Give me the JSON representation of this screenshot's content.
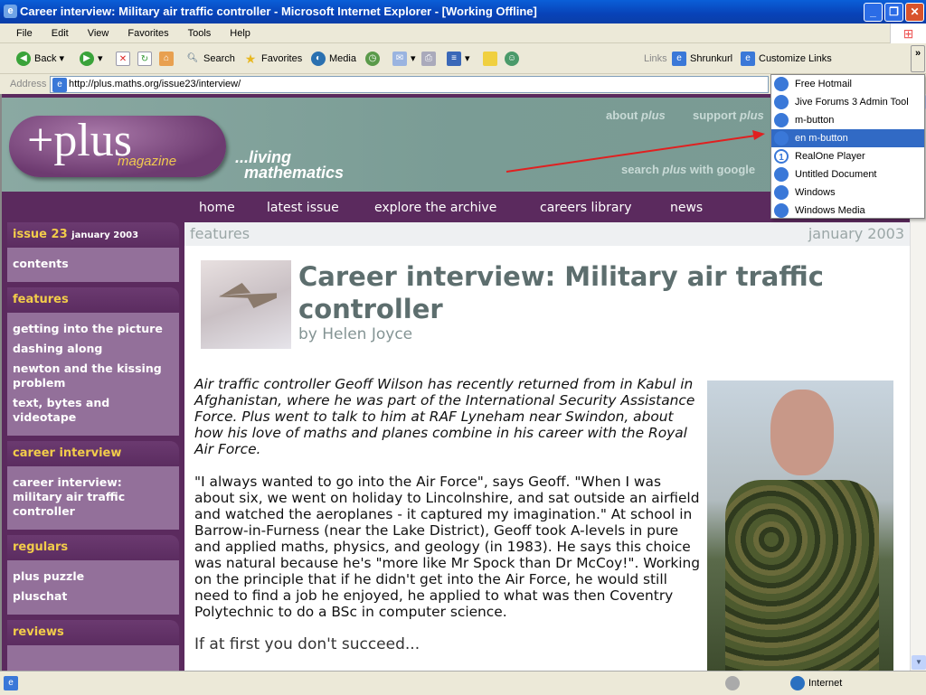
{
  "window": {
    "title": "Career interview: Military air traffic controller - Microsoft Internet Explorer - [Working Offline]"
  },
  "menu": [
    "File",
    "Edit",
    "View",
    "Favorites",
    "Tools",
    "Help"
  ],
  "toolbar": {
    "back": "Back",
    "search": "Search",
    "favorites": "Favorites",
    "media": "Media",
    "links": "Links",
    "link1": "Shrunkurl",
    "link2": "Customize Links",
    "chevron": "»"
  },
  "address": {
    "label": "Address",
    "url": "http://plus.maths.org/issue23/interview/"
  },
  "links_menu": {
    "items": [
      "Free Hotmail",
      "Jive Forums 3 Admin Tool",
      "m-button",
      "en m-button",
      "RealOne Player",
      "Untitled Document",
      "Windows",
      "Windows Media"
    ],
    "selected": 3
  },
  "banner": {
    "logo": "+plus",
    "logo_sub": "magazine",
    "tagline1": "...living",
    "tagline2": "mathematics",
    "about": "about",
    "support": "support",
    "plus": "plus",
    "search_pre": "search",
    "search_post": "with google"
  },
  "nav": [
    "home",
    "latest issue",
    "explore the archive",
    "careers library",
    "news"
  ],
  "sidebar": {
    "issue": "issue 23",
    "issue_date": "january 2003",
    "contents": "contents",
    "features_head": "features",
    "features": [
      "getting into the picture",
      "dashing along",
      "newton and the kissing problem",
      "text, bytes and videotape"
    ],
    "career_head": "career interview",
    "career": [
      "career interview: military air traffic controller"
    ],
    "regulars_head": "regulars",
    "regulars": [
      "plus puzzle",
      "pluschat"
    ],
    "reviews_head": "reviews"
  },
  "main": {
    "section": "features",
    "date": "january 2003",
    "title": "Career interview: Military air traffic controller",
    "author": "by Helen Joyce",
    "intro": "Air traffic controller Geoff Wilson has recently returned from in Kabul in Afghanistan, where he was part of the International Security Assistance Force. Plus went to talk to him at RAF Lyneham near Swindon, about how his love of maths and planes combine in his career with the Royal Air Force.",
    "para1": "\"I always wanted to go into the Air Force\", says Geoff. \"When I was about six, we went on holiday to Lincolnshire, and sat outside an airfield and watched the aeroplanes - it captured my imagination.\" At school in Barrow-in-Furness (near the Lake District), Geoff took A-levels in pure and applied maths, physics, and geology (in 1983). He says this choice was natural because he's \"more like Mr Spock than Dr McCoy!\". Working on the principle that if he didn't get into the Air Force, he would still need to find a job he enjoyed, he applied to what was then Coventry Polytechnic to do a BSc in computer science.",
    "subhead": "If at first you don't succeed..."
  },
  "status": {
    "zone": "Internet"
  },
  "colors": {
    "banner": "#7a9c95",
    "nav": "#5b2a5e",
    "sidebar": "#93709a",
    "heading_yellow": "#f2cc4a",
    "title": "#5d6e6e",
    "highlight": "#316ac5",
    "arrow": "#e02020"
  }
}
